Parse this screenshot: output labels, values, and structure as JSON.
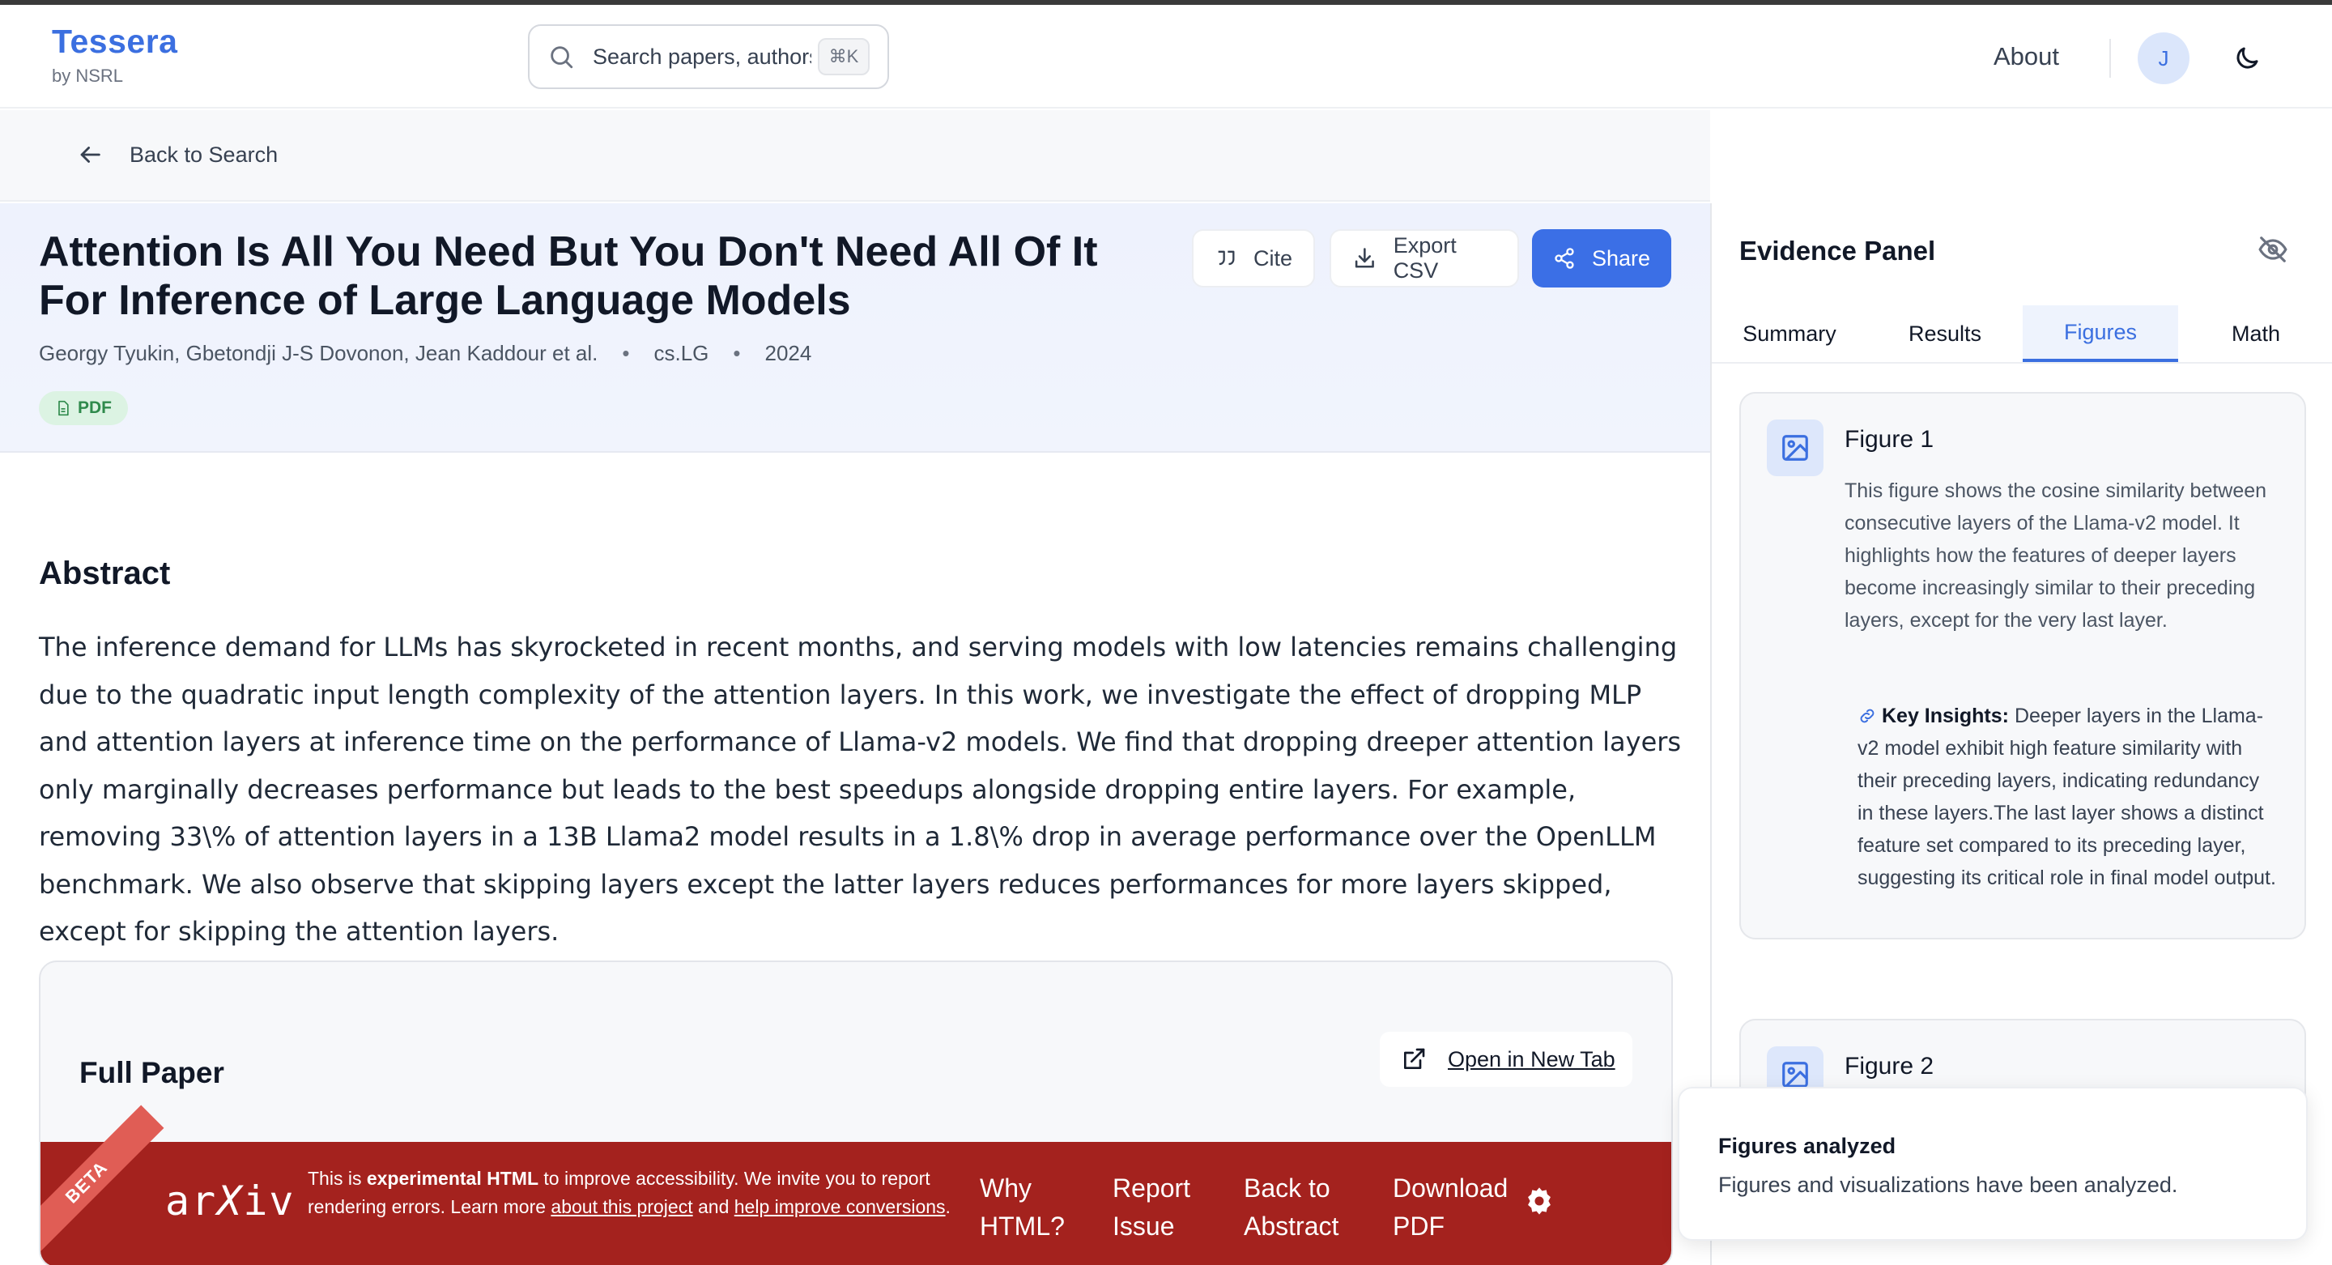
{
  "header": {
    "brand": "Tessera",
    "brand_sub": "by NSRL",
    "search_placeholder": "Search papers, authors...",
    "search_shortcut": "⌘K",
    "about_label": "About",
    "avatar_initial": "J"
  },
  "backbar": {
    "label": "Back to Search"
  },
  "paper": {
    "title": "Attention Is All You Need But You Don't Need All Of It For Inference of Large Language Models",
    "authors": "Georgy Tyukin, Gbetondji J-S Dovonon, Jean Kaddour et al.",
    "category": "cs.LG",
    "year": "2024",
    "pdf_badge": "PDF",
    "buttons": {
      "cite": "Cite",
      "export": "Export CSV",
      "share": "Share"
    }
  },
  "abstract": {
    "heading": "Abstract",
    "text": "The inference demand for LLMs has skyrocketed in recent months, and serving models with low latencies remains challenging due to the quadratic input length complexity of the attention layers. In this work, we investigate the effect of dropping MLP and attention layers at inference time on the performance of Llama-v2 models. We find that dropping dreeper attention layers only marginally decreases performance but leads to the best speedups alongside dropping entire layers. For example, removing 33\\% of attention layers in a 13B Llama2 model results in a 1.8\\% drop in average performance over the OpenLLM benchmark. We also observe that skipping layers except the latter layers reduces performances for more layers skipped, except for skipping the attention layers."
  },
  "full_paper": {
    "heading": "Full Paper",
    "open_new_tab": "Open in New Tab",
    "arxiv": {
      "beta": "BETA",
      "logo": "arXiv",
      "notice_pre": "This is ",
      "notice_bold": "experimental HTML",
      "notice_mid": " to improve accessibility. We invite you to report rendering errors. Learn more ",
      "notice_link1": "about this project",
      "notice_and": " and ",
      "notice_link2": "help improve conversions",
      "notice_end": ".",
      "links": [
        "Why HTML?",
        "Report Issue",
        "Back to Abstract",
        "Download PDF"
      ]
    }
  },
  "evidence": {
    "title": "Evidence Panel",
    "tabs": [
      "Summary",
      "Results",
      "Figures",
      "Math"
    ],
    "active_tab": "Figures",
    "figures": [
      {
        "name": "Figure 1",
        "description": "This figure shows the cosine similarity between consecutive layers of the Llama-v2 model. It highlights how the features of deeper layers become increasingly similar to their preceding layers, except for the very last layer.",
        "insight_label": "Key Insights:",
        "insight": "Deeper layers in the Llama-v2 model exhibit high feature similarity with their preceding layers, indicating redundancy in these layers.The last layer shows a distinct feature set compared to its preceding layer, suggesting its critical role in final model output."
      },
      {
        "name": "Figure 2"
      }
    ]
  },
  "toast": {
    "title": "Figures analyzed",
    "message": "Figures and visualizations have been analyzed."
  },
  "colors": {
    "accent": "#3b6fe0",
    "arxiv_red": "#a4221e",
    "pdf_green": "#2f8a4c"
  }
}
